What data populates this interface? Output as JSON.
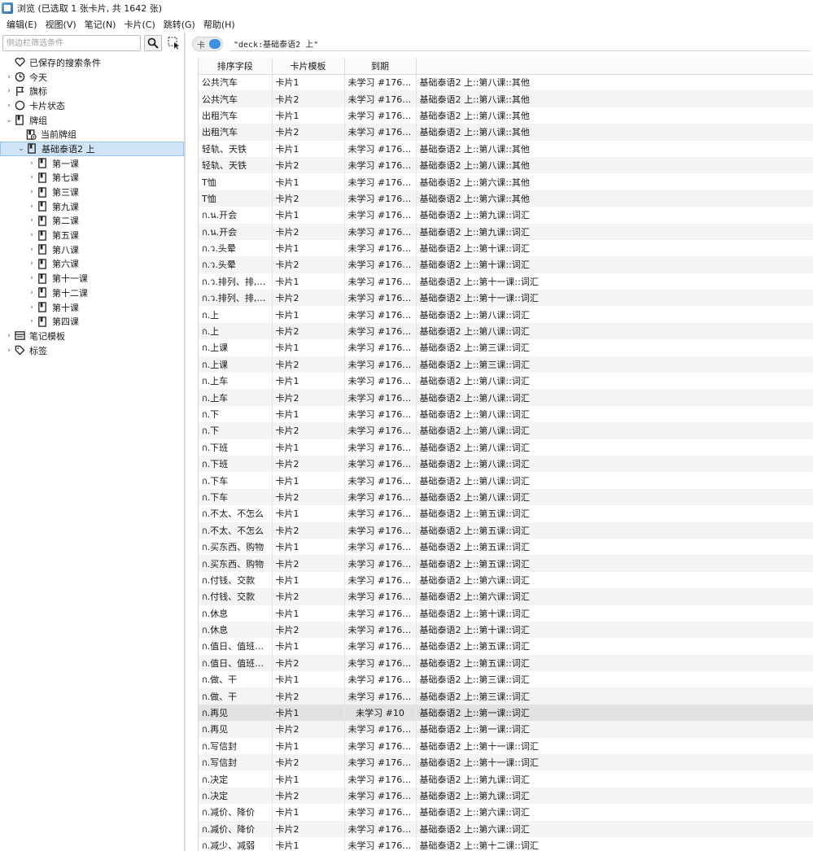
{
  "window": {
    "title": "浏览 (已选取 1 张卡片, 共 1642 张)"
  },
  "menu": [
    "编辑(E)",
    "视图(V)",
    "笔记(N)",
    "卡片(C)",
    "跳转(G)",
    "帮助(H)"
  ],
  "sidebar": {
    "search_placeholder": "侧边栏筛选条件",
    "items": [
      {
        "label": "已保存的搜索条件",
        "icon": "heart-icon",
        "chev": ""
      },
      {
        "label": "今天",
        "icon": "clock-icon",
        "chev": "›"
      },
      {
        "label": "旗标",
        "icon": "flag-icon",
        "chev": "›"
      },
      {
        "label": "卡片状态",
        "icon": "circle-icon",
        "chev": "›"
      },
      {
        "label": "牌组",
        "icon": "deck-icon",
        "chev": "⌄"
      },
      {
        "label": "当前牌组",
        "icon": "current-deck-icon",
        "chev": ""
      },
      {
        "label": "基础泰语2 上",
        "icon": "deck-icon",
        "chev": "⌄"
      },
      {
        "label": "第一课",
        "icon": "deck-icon",
        "chev": "›"
      },
      {
        "label": "第七课",
        "icon": "deck-icon",
        "chev": "›"
      },
      {
        "label": "第三课",
        "icon": "deck-icon",
        "chev": "›"
      },
      {
        "label": "第九课",
        "icon": "deck-icon",
        "chev": "›"
      },
      {
        "label": "第二课",
        "icon": "deck-icon",
        "chev": "›"
      },
      {
        "label": "第五课",
        "icon": "deck-icon",
        "chev": "›"
      },
      {
        "label": "第八课",
        "icon": "deck-icon",
        "chev": "›"
      },
      {
        "label": "第六课",
        "icon": "deck-icon",
        "chev": "›"
      },
      {
        "label": "第十一课",
        "icon": "deck-icon",
        "chev": "›"
      },
      {
        "label": "第十二课",
        "icon": "deck-icon",
        "chev": "›"
      },
      {
        "label": "第十课",
        "icon": "deck-icon",
        "chev": "›"
      },
      {
        "label": "第四课",
        "icon": "deck-icon",
        "chev": "›"
      },
      {
        "label": "笔记模板",
        "icon": "note-template-icon",
        "chev": "›"
      },
      {
        "label": "标签",
        "icon": "tag-icon",
        "chev": "›"
      }
    ]
  },
  "toolbar": {
    "toggle_label": "卡",
    "query": "\"deck:基础泰语2 上\""
  },
  "table": {
    "columns": [
      "排序字段",
      "卡片模板",
      "到期",
      ""
    ],
    "rows": [
      [
        "公共汽车",
        "卡片1",
        "未学习 #17604...",
        "基础泰语2 上::第八课::其他"
      ],
      [
        "公共汽车",
        "卡片2",
        "未学习 #17604...",
        "基础泰语2 上::第八课::其他"
      ],
      [
        "出租汽车",
        "卡片1",
        "未学习 #17604...",
        "基础泰语2 上::第八课::其他"
      ],
      [
        "出租汽车",
        "卡片2",
        "未学习 #17604...",
        "基础泰语2 上::第八课::其他"
      ],
      [
        "轻轨、天铁",
        "卡片1",
        "未学习 #17604...",
        "基础泰语2 上::第八课::其他"
      ],
      [
        "轻轨、天铁",
        "卡片2",
        "未学习 #17604...",
        "基础泰语2 上::第八课::其他"
      ],
      [
        "T恤",
        "卡片1",
        "未学习 #17603...",
        "基础泰语2 上::第六课::其他"
      ],
      [
        "T恤",
        "卡片2",
        "未学习 #17603...",
        "基础泰语2 上::第六课::其他"
      ],
      [
        "ก.น.开会",
        "卡片1",
        "未学习 #17604...",
        "基础泰语2 上::第九课::词汇"
      ],
      [
        "ก.น.开会",
        "卡片2",
        "未学习 #17604...",
        "基础泰语2 上::第九课::词汇"
      ],
      [
        "ก.ว.头晕",
        "卡片1",
        "未学习 #17605...",
        "基础泰语2 上::第十课::词汇"
      ],
      [
        "ก.ว.头晕",
        "卡片2",
        "未学习 #17605...",
        "基础泰语2 上::第十课::词汇"
      ],
      [
        "ก.ว.排列、排,并...",
        "卡片1",
        "未学习 #17606...",
        "基础泰语2 上::第十一课::词汇"
      ],
      [
        "ก.ว.排列、排,并...",
        "卡片2",
        "未学习 #17606...",
        "基础泰语2 上::第十一课::词汇"
      ],
      [
        "ก.上",
        "卡片1",
        "未学习 #17604...",
        "基础泰语2 上::第八课::词汇"
      ],
      [
        "ก.上",
        "卡片2",
        "未学习 #17604...",
        "基础泰语2 上::第八课::词汇"
      ],
      [
        "ก.上课",
        "卡片1",
        "未学习 #17600...",
        "基础泰语2 上::第三课::词汇"
      ],
      [
        "ก.上课",
        "卡片2",
        "未学习 #17600...",
        "基础泰语2 上::第三课::词汇"
      ],
      [
        "ก.上车",
        "卡片1",
        "未学习 #17604...",
        "基础泰语2 上::第八课::词汇"
      ],
      [
        "ก.上车",
        "卡片2",
        "未学习 #17604...",
        "基础泰语2 上::第八课::词汇"
      ],
      [
        "ก.下",
        "卡片1",
        "未学习 #17604...",
        "基础泰语2 上::第八课::词汇"
      ],
      [
        "ก.下",
        "卡片2",
        "未学习 #17604...",
        "基础泰语2 上::第八课::词汇"
      ],
      [
        "ก.下班",
        "卡片1",
        "未学习 #17604...",
        "基础泰语2 上::第八课::词汇"
      ],
      [
        "ก.下班",
        "卡片2",
        "未学习 #17604...",
        "基础泰语2 上::第八课::词汇"
      ],
      [
        "ก.下车",
        "卡片1",
        "未学习 #17604...",
        "基础泰语2 上::第八课::词汇"
      ],
      [
        "ก.下车",
        "卡片2",
        "未学习 #17604...",
        "基础泰语2 上::第八课::词汇"
      ],
      [
        "ก.不太、不怎么",
        "卡片1",
        "未学习 #17601...",
        "基础泰语2 上::第五课::词汇"
      ],
      [
        "ก.不太、不怎么",
        "卡片2",
        "未学习 #17601...",
        "基础泰语2 上::第五课::词汇"
      ],
      [
        "ก.买东西、购物",
        "卡片1",
        "未学习 #17602...",
        "基础泰语2 上::第五课::词汇"
      ],
      [
        "ก.买东西、购物",
        "卡片2",
        "未学习 #17602...",
        "基础泰语2 上::第五课::词汇"
      ],
      [
        "ก.付钱、交款",
        "卡片1",
        "未学习 #17602...",
        "基础泰语2 上::第六课::词汇"
      ],
      [
        "ก.付钱、交款",
        "卡片2",
        "未学习 #17602...",
        "基础泰语2 上::第六课::词汇"
      ],
      [
        "ก.休息",
        "卡片1",
        "未学习 #17605...",
        "基础泰语2 上::第十课::词汇"
      ],
      [
        "ก.休息",
        "卡片2",
        "未学习 #17605...",
        "基础泰语2 上::第十课::词汇"
      ],
      [
        "ก.值日、值班、...",
        "卡片1",
        "未学习 #17602...",
        "基础泰语2 上::第五课::词汇"
      ],
      [
        "ก.值日、值班、...",
        "卡片2",
        "未学习 #17602...",
        "基础泰语2 上::第五课::词汇"
      ],
      [
        "ก.做、干",
        "卡片1",
        "未学习 #17600...",
        "基础泰语2 上::第三课::词汇"
      ],
      [
        "ก.做、干",
        "卡片2",
        "未学习 #17600...",
        "基础泰语2 上::第三课::词汇"
      ],
      [
        "ก.再见",
        "卡片1",
        "未学习 #10",
        "基础泰语2 上::第一课::词汇"
      ],
      [
        "ก.再见",
        "卡片2",
        "未学习 #17607...",
        "基础泰语2 上::第一课::词汇"
      ],
      [
        "ก.写信封",
        "卡片1",
        "未学习 #17606...",
        "基础泰语2 上::第十一课::词汇"
      ],
      [
        "ก.写信封",
        "卡片2",
        "未学习 #17606...",
        "基础泰语2 上::第十一课::词汇"
      ],
      [
        "ก.决定",
        "卡片1",
        "未学习 #17605...",
        "基础泰语2 上::第九课::词汇"
      ],
      [
        "ก.决定",
        "卡片2",
        "未学习 #17605...",
        "基础泰语2 上::第九课::词汇"
      ],
      [
        "ก.减价、降价",
        "卡片1",
        "未学习 #17602...",
        "基础泰语2 上::第六课::词汇"
      ],
      [
        "ก.减价、降价",
        "卡片2",
        "未学习 #17602...",
        "基础泰语2 上::第六课::词汇"
      ],
      [
        "ก.减少、减弱",
        "卡片1",
        "未学习 #17607...",
        "基础泰语2 上::第十二课::词汇"
      ]
    ],
    "selected_row": 38
  },
  "colors": {
    "selection_sidebar": "#cfe4f7",
    "selection_row": "#e2e2e2",
    "accent": "#3d8fe0"
  }
}
